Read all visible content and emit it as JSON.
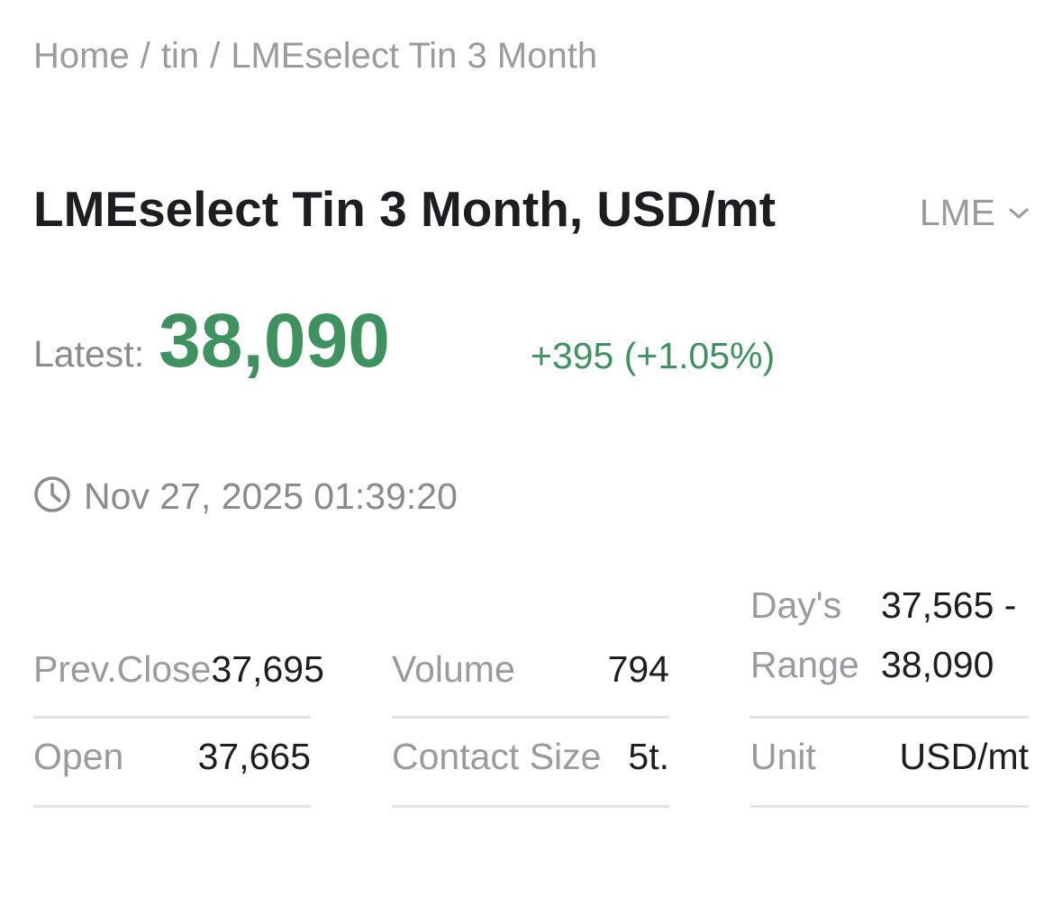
{
  "breadcrumb": {
    "home": "Home",
    "category": "tin",
    "current": "LMEselect Tin 3 Month",
    "separator": "/"
  },
  "header": {
    "title": "LMEselect Tin 3 Month, USD/mt",
    "exchange_selector": "LME"
  },
  "quote": {
    "latest_label": "Latest:",
    "latest_value": "38,090",
    "change": "+395 (+1.05%)",
    "timestamp": "Nov 27, 2025 01:39:20"
  },
  "stats": {
    "prev_close_label": "Prev.Close",
    "prev_close_value": "37,695",
    "open_label": "Open",
    "open_value": "37,665",
    "volume_label": "Volume",
    "volume_value": "794",
    "contract_size_label": "Contact Size",
    "contract_size_value": "5t.",
    "days_range_label_line1": "Day's",
    "days_range_label_line2": "Range",
    "days_range_value_line1": "37,565 -",
    "days_range_value_line2": "38,090",
    "unit_label": "Unit",
    "unit_value": "USD/mt"
  },
  "colors": {
    "positive": "#3f9260",
    "muted_text": "#9a9aa0",
    "primary_text": "#1e1e22",
    "divider": "#e3e3e6"
  },
  "icons": {
    "clock": "clock-icon",
    "dropdown": "chevron-down-icon"
  }
}
